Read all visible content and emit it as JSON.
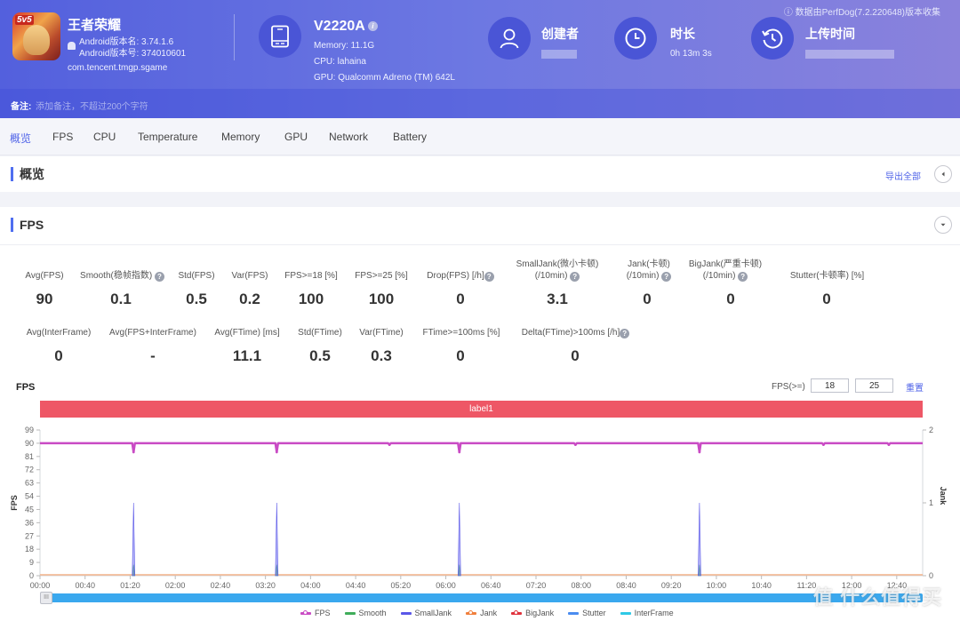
{
  "header": {
    "app": {
      "name": "王者荣耀",
      "badge": "5v5",
      "version_name": "Android版本名: 3.74.1.6",
      "version_code": "Android版本号: 374010601",
      "package": "com.tencent.tmgp.sgame"
    },
    "device": {
      "name": "V2220A",
      "info_glyph": "i",
      "memory": "Memory: 11.1G",
      "cpu": "CPU: lahaina",
      "gpu": "GPU: Qualcomm Adreno (TM) 642L"
    },
    "creator": {
      "title": "创建者",
      "value": ""
    },
    "duration": {
      "title": "时长",
      "value": "0h 13m 3s"
    },
    "upload_time": {
      "title": "上传时间",
      "value": ""
    },
    "collect_note": "ⓘ 数据由PerfDog(7.2.220648)版本收集",
    "note": {
      "label": "备注:",
      "placeholder": "添加备注，不超过200个字符"
    }
  },
  "tabs": [
    {
      "label": "概览",
      "active": true
    },
    {
      "label": "FPS"
    },
    {
      "label": "CPU"
    },
    {
      "label": "Temperature"
    },
    {
      "label": "Memory"
    },
    {
      "label": "GPU"
    },
    {
      "label": "Network"
    },
    {
      "label": "Battery"
    }
  ],
  "overview": {
    "title": "概览",
    "export_label": "导出全部"
  },
  "fps_panel": {
    "title": "FPS",
    "metrics_row1": [
      {
        "label": "Avg(FPS)",
        "value": "90"
      },
      {
        "label": "Smooth(稳帧指数)",
        "help": true,
        "value": "0.1"
      },
      {
        "label": "Std(FPS)",
        "value": "0.5"
      },
      {
        "label": "Var(FPS)",
        "value": "0.2"
      },
      {
        "label": "FPS>=18 [%]",
        "value": "100"
      },
      {
        "label": "FPS>=25 [%]",
        "value": "100"
      },
      {
        "label": "Drop(FPS) [/h]",
        "help": true,
        "value": "0"
      },
      {
        "label": "SmallJank(微小卡顿)",
        "label2": "(/10min)",
        "help": true,
        "value": "3.1"
      },
      {
        "label": "Jank(卡顿)",
        "label2": "(/10min)",
        "help": true,
        "value": "0"
      },
      {
        "label": "BigJank(严重卡顿)",
        "label2": "(/10min)",
        "help": true,
        "value": "0"
      },
      {
        "label": "Stutter(卡顿率) [%]",
        "value": "0"
      }
    ],
    "metrics_row2": [
      {
        "label": "Avg(InterFrame)",
        "value": "0"
      },
      {
        "label": "Avg(FPS+InterFrame)",
        "value": "-"
      },
      {
        "label": "Avg(FTime) [ms]",
        "value": "11.1"
      },
      {
        "label": "Std(FTime)",
        "value": "0.5"
      },
      {
        "label": "Var(FTime)",
        "value": "0.3"
      },
      {
        "label": "FTime>=100ms [%]",
        "value": "0"
      },
      {
        "label": "Delta(FTime)>100ms [/h]",
        "help": true,
        "value": "0"
      }
    ],
    "help_glyph": "?",
    "chart_header": {
      "title": "FPS",
      "threshold_label": "FPS(>=)",
      "threshold1": "18",
      "threshold2": "25",
      "reset_label": "重置"
    },
    "label_band": "label1",
    "slider_handle_glyph": "III"
  },
  "chart_data": {
    "type": "line",
    "title": "FPS",
    "xlabel": "",
    "ylabel": "FPS",
    "y2label": "Jank",
    "ylim": [
      0,
      99
    ],
    "y2lim": [
      0,
      2
    ],
    "yticks": [
      "0",
      "9",
      "18",
      "27",
      "36",
      "45",
      "54",
      "63",
      "72",
      "81",
      "90",
      "99"
    ],
    "y2ticks": [
      "0",
      "1",
      "2"
    ],
    "xlim_seconds": [
      0,
      783
    ],
    "xticks": [
      "00:00",
      "00:40",
      "01:20",
      "02:00",
      "02:40",
      "03:20",
      "04:00",
      "04:40",
      "05:20",
      "06:00",
      "06:40",
      "07:20",
      "08:00",
      "08:40",
      "09:20",
      "10:00",
      "10:40",
      "11:20",
      "12:00",
      "12:40"
    ],
    "series": [
      {
        "name": "FPS",
        "color": "#c94bc4",
        "axis": "left",
        "baseline": 90,
        "dips": [
          {
            "t": 83,
            "v": 84
          },
          {
            "t": 210,
            "v": 84
          },
          {
            "t": 310,
            "v": 89
          },
          {
            "t": 372,
            "v": 84
          },
          {
            "t": 475,
            "v": 89
          },
          {
            "t": 585,
            "v": 84
          },
          {
            "t": 695,
            "v": 89
          },
          {
            "t": 753,
            "v": 89
          }
        ]
      },
      {
        "name": "Smooth",
        "color": "#3fad5a",
        "axis": "right",
        "baseline": 0,
        "spikes": [
          {
            "t": 83,
            "v": 0.15
          },
          {
            "t": 210,
            "v": 0.15
          },
          {
            "t": 372,
            "v": 0.15
          },
          {
            "t": 585,
            "v": 0.15
          }
        ]
      },
      {
        "name": "SmallJank",
        "color": "#5a57e8",
        "axis": "right",
        "baseline": 0,
        "spikes": [
          {
            "t": 83,
            "v": 1
          },
          {
            "t": 210,
            "v": 1
          },
          {
            "t": 372,
            "v": 1
          },
          {
            "t": 585,
            "v": 1
          }
        ]
      },
      {
        "name": "Jank",
        "color": "#f07f3c",
        "axis": "right",
        "baseline": 0,
        "spikes": []
      },
      {
        "name": "BigJank",
        "color": "#e0323c",
        "axis": "right",
        "baseline": 0,
        "spikes": []
      },
      {
        "name": "Stutter",
        "color": "#4a8cf0",
        "axis": "right",
        "baseline": 0,
        "spikes": []
      },
      {
        "name": "InterFrame",
        "color": "#2ec9e6",
        "axis": "right",
        "baseline": 0,
        "spikes": []
      }
    ],
    "legend_position": "bottom",
    "grid": false
  },
  "watermark": "值 什么值得买"
}
